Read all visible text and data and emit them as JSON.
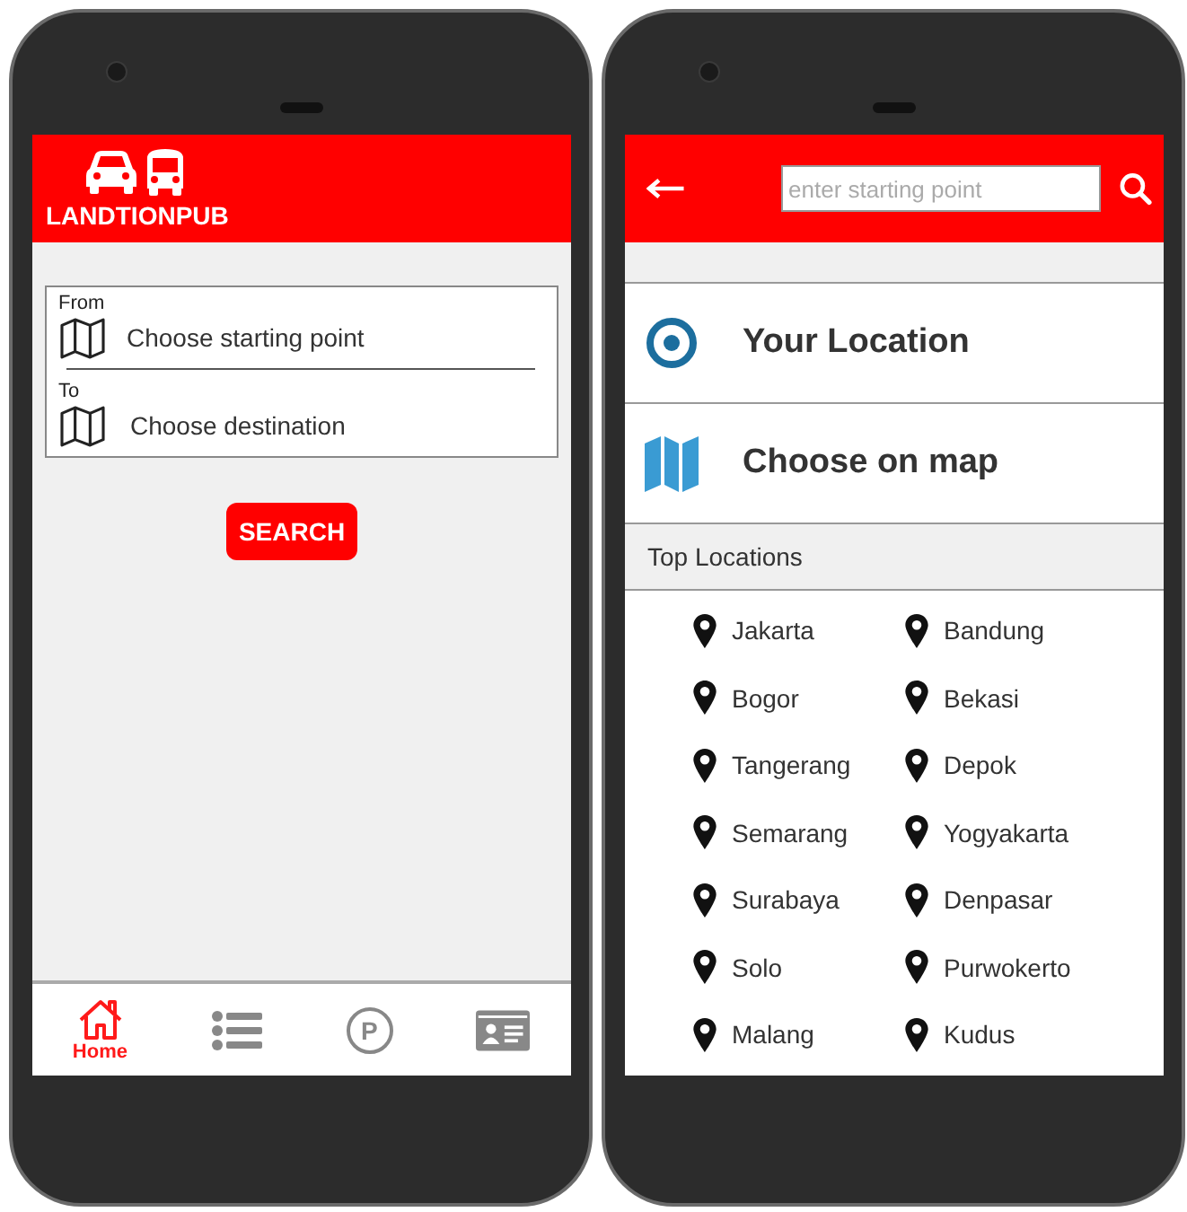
{
  "home_screen": {
    "brand": "LANDTIONPUB",
    "route_card": [
      {
        "kind": "from",
        "label": "From",
        "value": "Choose starting point"
      },
      {
        "kind": "to",
        "label": "To",
        "value": "Choose destination"
      }
    ],
    "search_button": "SEARCH",
    "bottom_nav": [
      {
        "kind": "home",
        "label": "Home",
        "selected": true
      },
      {
        "kind": "list",
        "selected": false
      },
      {
        "kind": "parking",
        "label": "P",
        "selected": false
      },
      {
        "kind": "id-card",
        "selected": false
      }
    ]
  },
  "location_screen": {
    "search": {
      "placeholder": "enter starting point"
    },
    "options": [
      {
        "kind": "current",
        "label": "Your Location"
      },
      {
        "kind": "map",
        "label": "Choose on map"
      }
    ],
    "top_locations_title": "Top Locations",
    "top_locations": [
      "Jakarta",
      "Bandung",
      "Bogor",
      "Bekasi",
      "Tangerang",
      "Depok",
      "Semarang",
      "Yogyakarta",
      "Surabaya",
      "Denpasar",
      "Solo",
      "Purwokerto",
      "Malang",
      "Kudus"
    ]
  }
}
